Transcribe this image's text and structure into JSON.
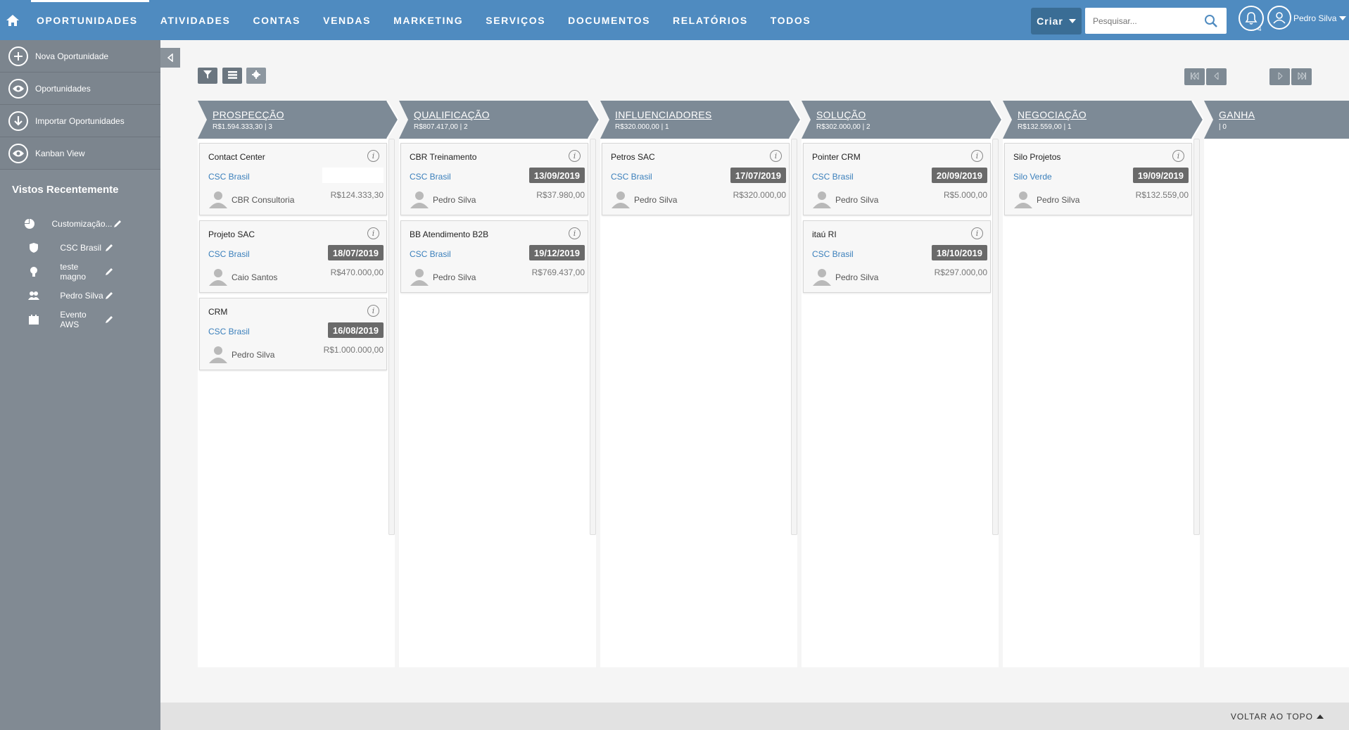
{
  "topnav": {
    "items": [
      "Oportunidades",
      "Atividades",
      "Contas",
      "Vendas",
      "Marketing",
      "Serviços",
      "Documentos",
      "Relatórios",
      "Todos"
    ],
    "create_label": "Criar",
    "search_placeholder": "Pesquisar...",
    "notification_count": "4",
    "user_name": "Pedro Silva"
  },
  "sidebar": {
    "actions": [
      "Nova Oportunidade",
      "Oportunidades",
      "Importar Oportunidades",
      "Kanban View"
    ],
    "recent_title": "Vistos Recentemente",
    "recent_items": [
      "Customização...",
      "CSC Brasil",
      "teste magno",
      "Pedro Silva",
      "Evento AWS"
    ]
  },
  "columns": [
    {
      "title": "Prospecção",
      "summary": "R$1.594.333,30 | 3",
      "cards": [
        {
          "title": "Contact Center",
          "account": "CSC Brasil",
          "date": "",
          "owner": "CBR Consultoria",
          "amount": "R$124.333,30"
        },
        {
          "title": "Projeto SAC",
          "account": "CSC Brasil",
          "date": "18/07/2019",
          "owner": "Caio Santos",
          "amount": "R$470.000,00"
        },
        {
          "title": "CRM",
          "account": "CSC Brasil",
          "date": "16/08/2019",
          "owner": "Pedro Silva",
          "amount": "R$1.000.000,00"
        }
      ]
    },
    {
      "title": "Qualificação",
      "summary": "R$807.417,00 | 2",
      "cards": [
        {
          "title": "CBR Treinamento",
          "account": "CSC Brasil",
          "date": "13/09/2019",
          "owner": "Pedro Silva",
          "amount": "R$37.980,00"
        },
        {
          "title": "BB Atendimento B2B",
          "account": "CSC Brasil",
          "date": "19/12/2019",
          "owner": "Pedro Silva",
          "amount": "R$769.437,00"
        }
      ]
    },
    {
      "title": "Influenciadores",
      "summary": "R$320.000,00 | 1",
      "cards": [
        {
          "title": "Petros SAC",
          "account": "CSC Brasil",
          "date": "17/07/2019",
          "owner": "Pedro Silva",
          "amount": "R$320.000,00"
        }
      ]
    },
    {
      "title": "Solução",
      "summary": "R$302.000,00 | 2",
      "cards": [
        {
          "title": "Pointer CRM",
          "account": "CSC Brasil",
          "date": "20/09/2019",
          "owner": "Pedro Silva",
          "amount": "R$5.000,00"
        },
        {
          "title": "itaú RI",
          "account": "CSC Brasil",
          "date": "18/10/2019",
          "owner": "Pedro Silva",
          "amount": "R$297.000,00"
        }
      ]
    },
    {
      "title": "Negociação",
      "summary": "R$132.559,00 | 1",
      "cards": [
        {
          "title": "Silo Projetos",
          "account": "Silo Verde",
          "date": "19/09/2019",
          "owner": "Pedro Silva",
          "amount": "R$132.559,00"
        }
      ]
    },
    {
      "title": "Ganha",
      "summary": "| 0",
      "cards": []
    }
  ],
  "footer": {
    "back_to_top": "VOLTAR AO TOPO"
  },
  "colors": {
    "nav": "#4f8bc0",
    "sidebar": "#818a93",
    "header_arrow": "#7d8a96",
    "date_badge": "#6a6a6a",
    "link": "#3a7fbb"
  }
}
